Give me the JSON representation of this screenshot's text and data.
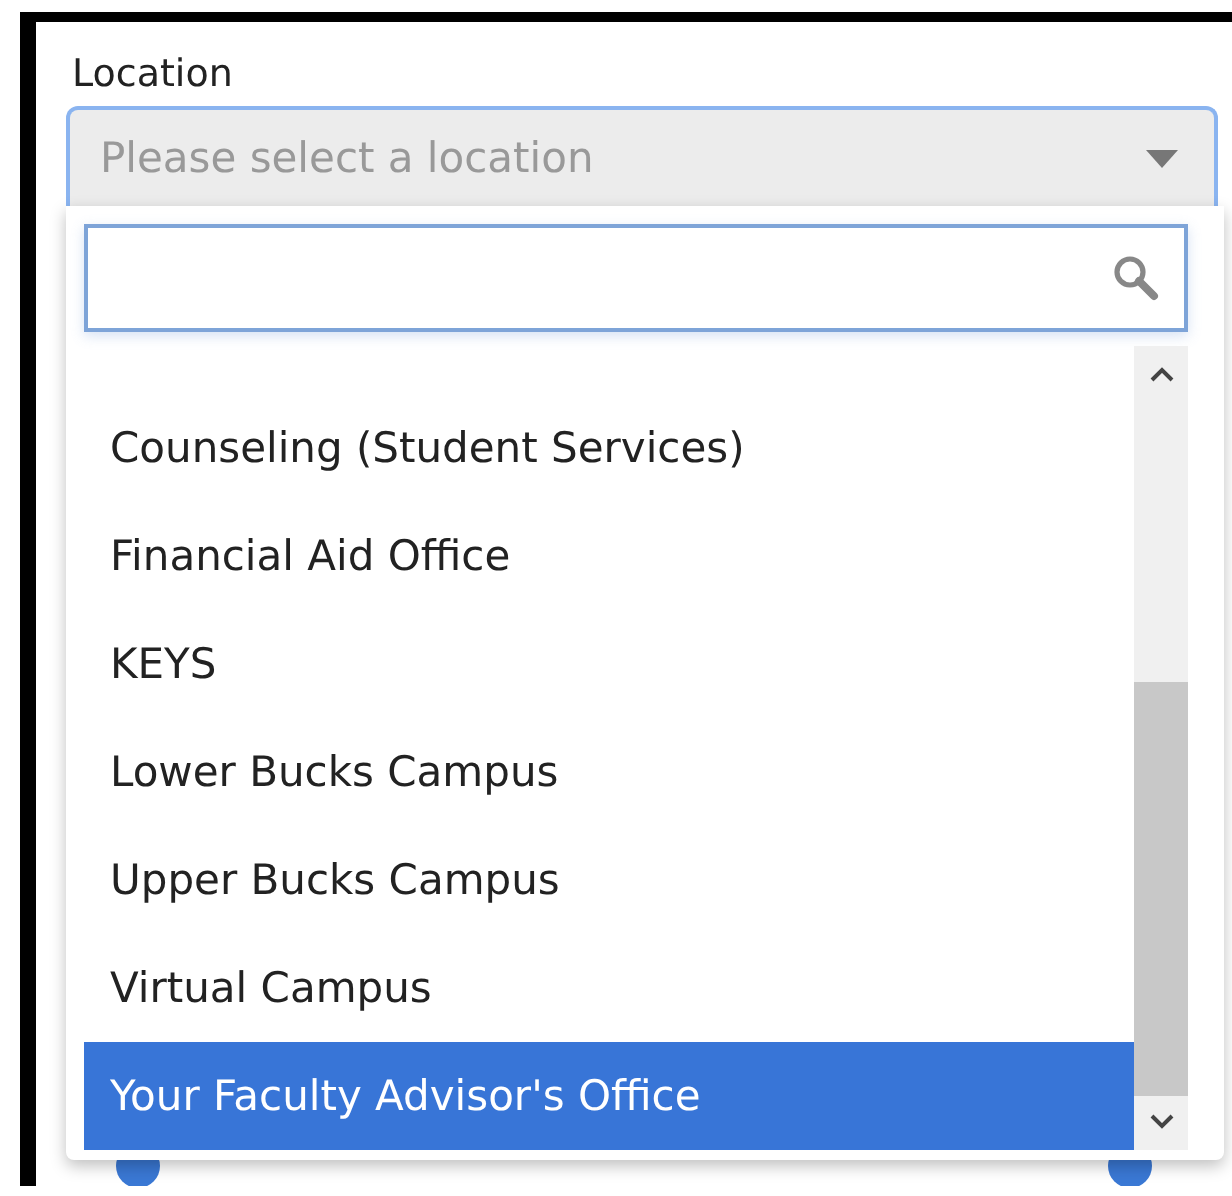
{
  "field": {
    "label": "Location",
    "placeholder": "Please select a location"
  },
  "dropdown": {
    "options": [
      {
        "label": "Counseling (Student Services)",
        "selected": false
      },
      {
        "label": "Financial Aid Office",
        "selected": false
      },
      {
        "label": "KEYS",
        "selected": false
      },
      {
        "label": "Lower Bucks Campus",
        "selected": false
      },
      {
        "label": "Upper Bucks Campus",
        "selected": false
      },
      {
        "label": "Virtual Campus",
        "selected": false
      },
      {
        "label": "Your Faculty Advisor's Office",
        "selected": true
      }
    ]
  }
}
